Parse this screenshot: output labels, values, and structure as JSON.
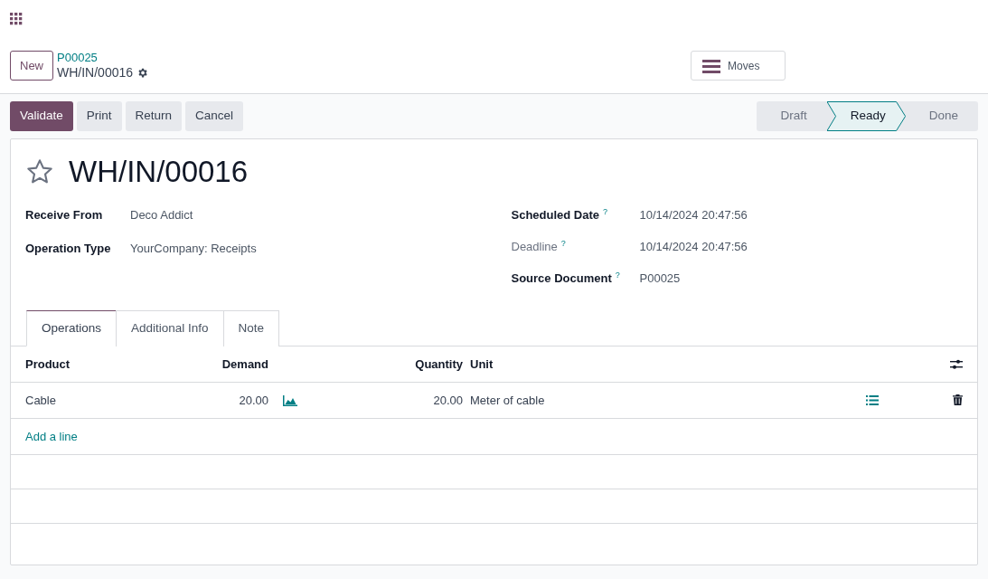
{
  "breadcrumb": {
    "parent": "P00025",
    "current": "WH/IN/00016"
  },
  "new_button": "New",
  "smart_buttons": [
    {
      "label": "Moves"
    }
  ],
  "actions": [
    {
      "label": "Validate",
      "primary": true
    },
    {
      "label": "Print",
      "primary": false
    },
    {
      "label": "Return",
      "primary": false
    },
    {
      "label": "Cancel",
      "primary": false
    }
  ],
  "status_stages": [
    {
      "label": "Draft",
      "selected": false
    },
    {
      "label": "Ready",
      "selected": true
    },
    {
      "label": "Done",
      "selected": false
    }
  ],
  "record": {
    "title": "WH/IN/00016",
    "starred": false
  },
  "fields_left": [
    {
      "label": "Receive From",
      "value": "Deco Addict",
      "muted": false
    },
    {
      "label": "Operation Type",
      "value": "YourCompany: Receipts",
      "muted": false
    }
  ],
  "fields_right": [
    {
      "label": "Scheduled Date",
      "help": "?",
      "value": "10/14/2024 20:47:56",
      "muted": false
    },
    {
      "label": "Deadline",
      "help": "?",
      "value": "10/14/2024 20:47:56",
      "muted": true
    },
    {
      "label": "Source Document",
      "help": "?",
      "value": "P00025",
      "muted": false
    }
  ],
  "tabs": [
    {
      "label": "Operations",
      "selected": true
    },
    {
      "label": "Additional Info",
      "selected": false
    },
    {
      "label": "Note",
      "selected": false
    }
  ],
  "table": {
    "columns": [
      "Product",
      "Demand",
      "Quantity",
      "Unit"
    ],
    "rows": [
      {
        "product": "Cable",
        "demand": "20.00",
        "quantity": "20.00",
        "unit": "Meter of cable"
      }
    ],
    "add_line": "Add a line"
  }
}
